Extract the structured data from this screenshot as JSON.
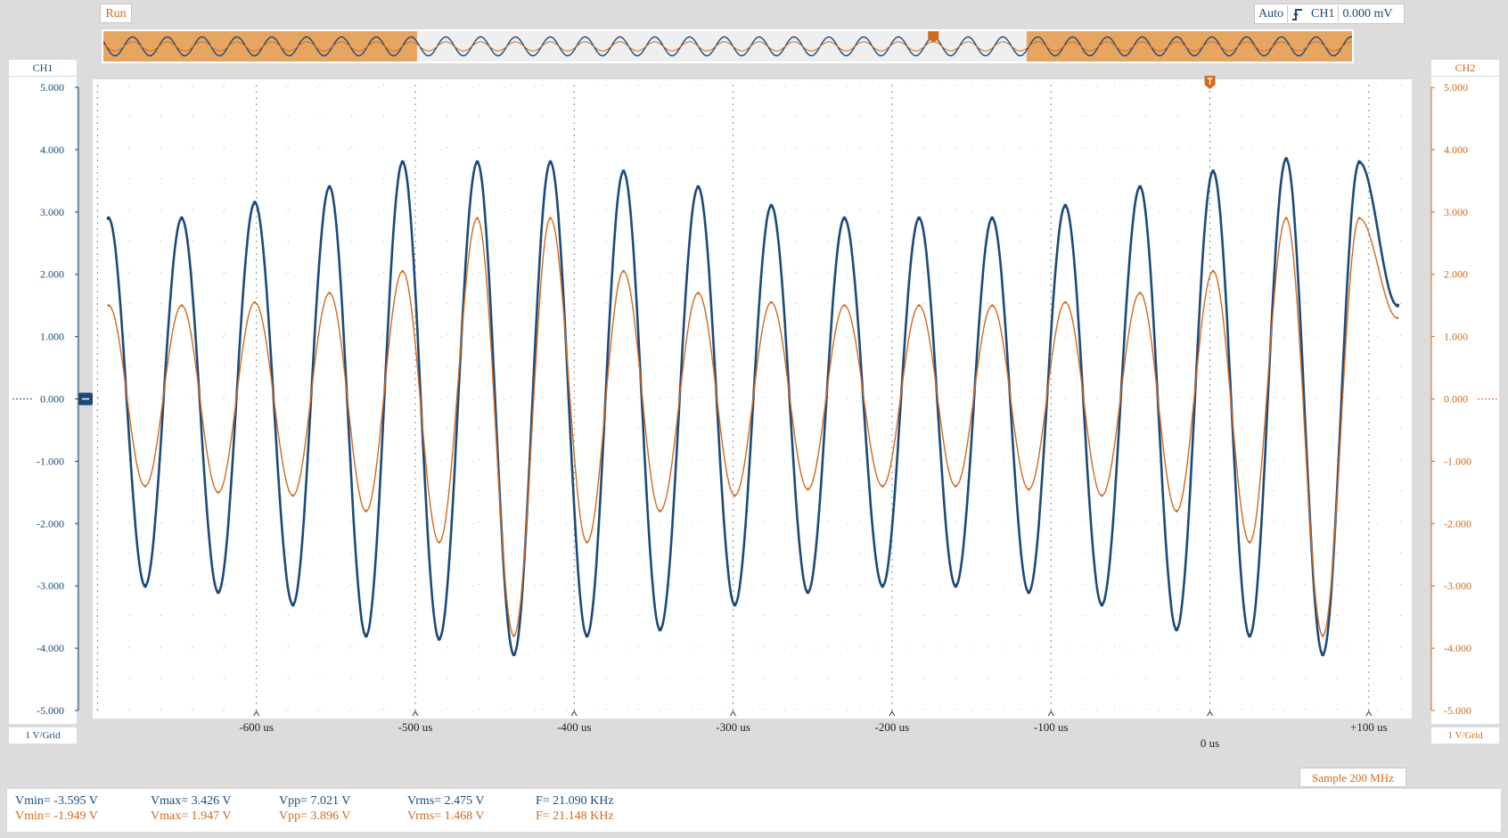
{
  "toolbar": {
    "run_label": "Run",
    "trigger_mode": "Auto",
    "trigger_icon": "rising-edge-icon",
    "trigger_source": "CH1",
    "trigger_level": "0.000 mV"
  },
  "channels": {
    "ch1": {
      "label": "CH1",
      "scale": "1 V/Grid",
      "color": "#1b4a7a"
    },
    "ch2": {
      "label": "CH2",
      "scale": "1 V/Grid",
      "color": "#d2691e"
    }
  },
  "sample_rate": "Sample 200 MHz",
  "measurements": {
    "ch1": {
      "vmin": "Vmin= -3.595 V",
      "vmax": "Vmax= 3.426 V",
      "vpp": "Vpp= 7.021 V",
      "vrms": "Vrms= 2.475 V",
      "freq": "F= 21.090 KHz"
    },
    "ch2": {
      "vmin": "Vmin= -1.949 V",
      "vmax": "Vmax= 1.947 V",
      "vpp": "Vpp= 3.896 V",
      "vrms": "Vrms= 1.468 V",
      "freq": "F= 21.148 KHz"
    }
  },
  "chart_data": {
    "type": "line",
    "xlabel": "",
    "ylabel": "",
    "x_unit": "us",
    "xlim": [
      -703,
      127
    ],
    "ylim": [
      -5,
      5
    ],
    "x_tick_labels": [
      "-600 us",
      "-500 us",
      "-400 us",
      "-300 us",
      "-200 us",
      "-100 us",
      "0 us",
      "+100 us"
    ],
    "x_tick_values": [
      -600,
      -500,
      -400,
      -300,
      -200,
      -100,
      0,
      100
    ],
    "y_tick_labels_left": [
      "5.000",
      "4.000",
      "3.000",
      "2.000",
      "1.000",
      "0.000",
      "-1.000",
      "-2.000",
      "-3.000",
      "-4.000",
      "-5.000"
    ],
    "y_tick_labels_right": [
      "5.000",
      "4.000",
      "3.000",
      "2.000",
      "1.000",
      "0.000",
      "-1.000",
      "-2.000",
      "-3.000",
      "-4.000",
      "-5.000"
    ],
    "y_tick_values": [
      5,
      4,
      3,
      2,
      1,
      0,
      -1,
      -2,
      -3,
      -4,
      -5
    ],
    "grid": true,
    "trigger_time": 0,
    "series": [
      {
        "name": "CH1",
        "color": "#1b4a7a",
        "x": [
          -693,
          -670,
          -647,
          -624,
          -601,
          -577,
          -554,
          -531,
          -508,
          -485,
          -461,
          -438,
          -415,
          -392,
          -369,
          -346,
          -322,
          -299,
          -276,
          -253,
          -230,
          -206,
          -183,
          -160,
          -137,
          -114,
          -91,
          -68,
          -44,
          -21,
          2,
          25,
          48,
          71,
          94,
          118
        ],
        "values": [
          2.9,
          -3.0,
          2.9,
          -3.1,
          3.15,
          -3.3,
          3.4,
          -3.8,
          3.8,
          -3.85,
          3.8,
          -4.1,
          3.8,
          -3.8,
          3.65,
          -3.7,
          3.4,
          -3.3,
          3.1,
          -3.1,
          2.9,
          -3.0,
          2.9,
          -3.0,
          2.9,
          -3.1,
          3.1,
          -3.3,
          3.4,
          -3.7,
          3.65,
          -3.8,
          3.85,
          -4.1,
          3.8,
          1.5
        ]
      },
      {
        "name": "CH2",
        "color": "#d2691e",
        "x": [
          -693,
          -670,
          -647,
          -624,
          -601,
          -577,
          -554,
          -531,
          -508,
          -485,
          -461,
          -438,
          -415,
          -392,
          -369,
          -346,
          -322,
          -299,
          -276,
          -253,
          -230,
          -206,
          -183,
          -160,
          -137,
          -114,
          -91,
          -68,
          -44,
          -21,
          2,
          25,
          48,
          71,
          94,
          118
        ],
        "values": [
          1.5,
          -1.4,
          1.5,
          -1.5,
          1.55,
          -1.55,
          1.7,
          -1.8,
          2.05,
          -2.3,
          2.9,
          -3.8,
          2.9,
          -2.3,
          2.05,
          -1.8,
          1.7,
          -1.55,
          1.55,
          -1.45,
          1.5,
          -1.4,
          1.5,
          -1.4,
          1.5,
          -1.45,
          1.55,
          -1.55,
          1.7,
          -1.8,
          2.05,
          -2.3,
          2.9,
          -3.8,
          2.9,
          1.3
        ]
      }
    ]
  }
}
